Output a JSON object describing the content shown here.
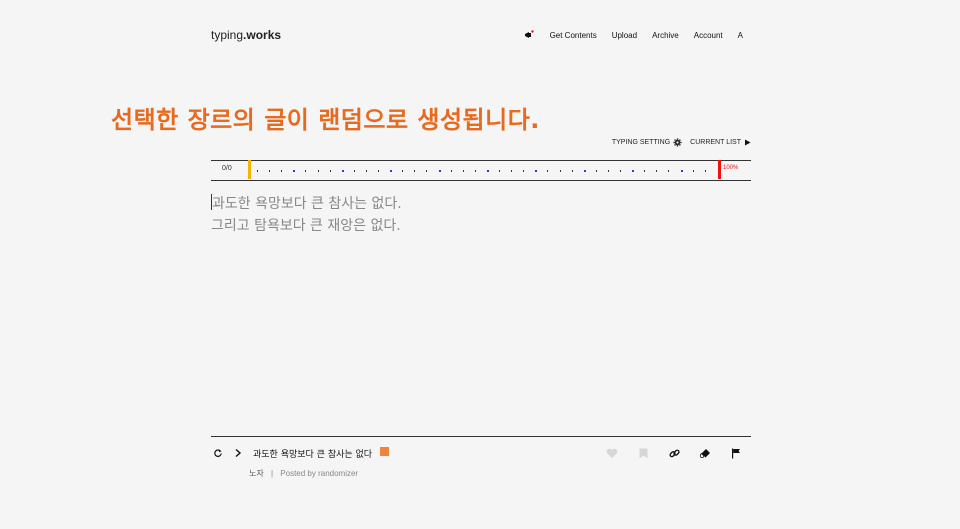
{
  "header": {
    "logo_light": "typing",
    "logo_bold": ".works",
    "nav": {
      "get_contents": "Get Contents",
      "upload": "Upload",
      "archive": "Archive",
      "account": "Account",
      "lang": "A"
    }
  },
  "banner": "선택한 장르의 글이 랜덤으로 생성됩니다.",
  "settings": {
    "typing_setting": "TYPING SETTING",
    "current_list": "CURRENT LIST"
  },
  "progress": {
    "count": "0/0",
    "percent": "100%"
  },
  "typing_text": {
    "line1": "과도한 욕망보다 큰 참사는 없다.",
    "line2": "그리고 탐욕보다 큰 재앙은 없다."
  },
  "footer": {
    "title": "과도한 욕망보다 큰 참사는 없다",
    "author": "노자",
    "separator": "|",
    "posted_by": "Posted by randomizer"
  },
  "colors": {
    "accent": "#e66a1f",
    "progress_start": "#f5b400",
    "progress_end": "#e11111",
    "marker_blue": "#2a3cd1"
  },
  "icons": [
    "megaphone-icon",
    "gear-icon",
    "play-icon",
    "refresh-icon",
    "chevron-right-icon",
    "external-link-icon",
    "heart-icon",
    "bookmark-icon",
    "link-icon",
    "eraser-icon",
    "flag-icon"
  ]
}
